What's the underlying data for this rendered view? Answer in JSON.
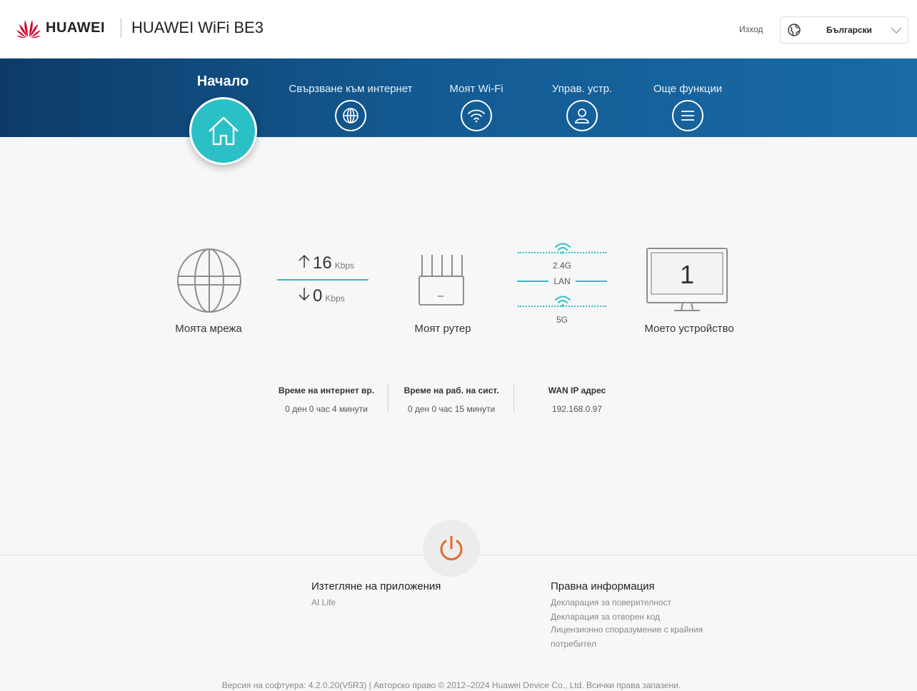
{
  "header": {
    "brand": "HUAWEI",
    "product": "HUAWEI WiFi BE3",
    "logout": "Изход",
    "language": "Български"
  },
  "nav": {
    "active": "Начало",
    "items": [
      {
        "label": "Свързване към интернет",
        "icon": "globe-icon"
      },
      {
        "label": "Моят Wi-Fi",
        "icon": "wifi-icon"
      },
      {
        "label": "Управ. устр.",
        "icon": "user-icon"
      },
      {
        "label": "Още функции",
        "icon": "menu-icon"
      }
    ]
  },
  "status": {
    "network_label": "Моята мрежа",
    "upload_value": "16",
    "download_value": "0",
    "speed_unit": "Kbps",
    "router_label": "Моят рутер",
    "band_24": "2.4G",
    "lan": "LAN",
    "band_5": "5G",
    "device_count": "1",
    "device_label": "Моето устройство"
  },
  "info": [
    {
      "title": "Време на интернет вр.",
      "value": "0 ден 0 час 4 минути"
    },
    {
      "title": "Време на раб. на сист.",
      "value": "0 ден 0 час 15 минути"
    },
    {
      "title": "WAN IP адрес",
      "value": "192.168.0.97"
    }
  ],
  "footer": {
    "apps_title": "Изтегляне на приложения",
    "apps_link": "AI Life",
    "legal_title": "Правна информация",
    "legal_links": [
      "Декларация за поверителност",
      "Декларация за отворен код",
      "Лицензионно споразумение с крайния потребител"
    ],
    "copyright": "Версия на софтуера: 4.2.0.20(V5R3) |  Авторско право © 2012–2024 Huawei Device Co., Ltd. Всички права запазени."
  },
  "colors": {
    "accent": "#2bbfc6",
    "nav_dark": "#0d3b68",
    "nav_light": "#1a6aa6",
    "power": "#e8672a",
    "brand_red": "#cf0a2c"
  }
}
